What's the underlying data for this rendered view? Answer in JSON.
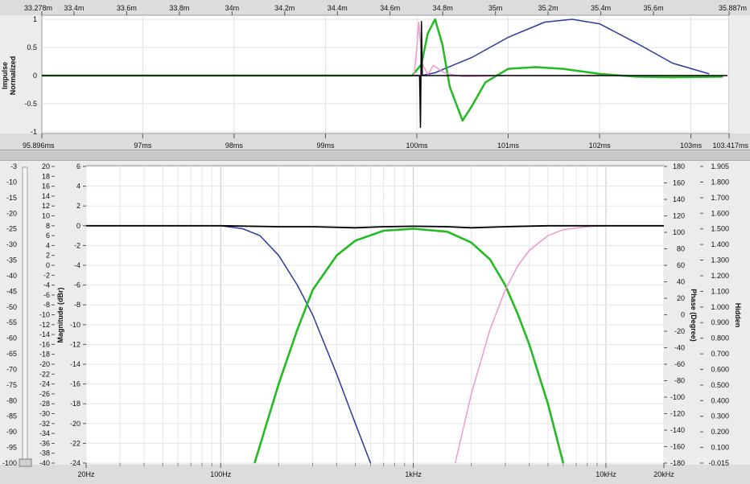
{
  "impulse_panel": {
    "ylabel_line1": "Impulse",
    "ylabel_line2": "Normalized",
    "top_ticks": [
      "33.278m",
      "33.4m",
      "33.6m",
      "33.8m",
      "34m",
      "34.2m",
      "34.4m",
      "34.6m",
      "34.8m",
      "35m",
      "35.2m",
      "35.4m",
      "35.6m",
      "35.887m"
    ],
    "bottom_ticks": [
      "95.896ms",
      "97ms",
      "98ms",
      "99ms",
      "100ms",
      "101ms",
      "102ms",
      "103ms",
      "103.417ms"
    ],
    "y_ticks": [
      "1",
      "0.5",
      "0",
      "-0.5",
      "-1"
    ]
  },
  "response_panel": {
    "left_scale_ticks": [
      "-3",
      "-10",
      "-15",
      "-20",
      "-25",
      "-30",
      "-35",
      "-40",
      "-45",
      "-50",
      "-55",
      "-60",
      "-65",
      "-70",
      "-75",
      "-80",
      "-85",
      "-90",
      "-95",
      "-100"
    ],
    "mag_ticks": [
      "20",
      "18",
      "16",
      "14",
      "12",
      "10",
      "8",
      "6",
      "4",
      "2",
      "0",
      "-2",
      "-4",
      "-6",
      "-8",
      "-10",
      "-12",
      "-14",
      "-16",
      "-18",
      "-20",
      "-22",
      "-24",
      "-26",
      "-28",
      "-30",
      "-32",
      "-34",
      "-36",
      "-38",
      "-40"
    ],
    "grid_ticks": [
      "6",
      "4",
      "2",
      "0",
      "-2",
      "-4",
      "-6",
      "-8",
      "-10",
      "-12",
      "-14",
      "-16",
      "-18",
      "-20",
      "-22",
      "-24"
    ],
    "phase_ticks": [
      "180",
      "160",
      "140",
      "120",
      "100",
      "80",
      "60",
      "40",
      "20",
      "0",
      "-20",
      "-40",
      "-60",
      "-80",
      "-100",
      "-120",
      "-140",
      "-160",
      "-180"
    ],
    "hidden_ticks": [
      "1.905",
      "1.800",
      "1.700",
      "1.600",
      "1.500",
      "1.400",
      "1.300",
      "1.200",
      "1.100",
      "1.000",
      "0.900",
      "0.800",
      "0.700",
      "0.600",
      "0.500",
      "0.400",
      "0.300",
      "0.200",
      "0.100",
      "-0.015"
    ],
    "freq_ticks": [
      "20Hz",
      "100Hz",
      "1kHz",
      "10kHz",
      "20kHz"
    ],
    "mag_label": "Magnitude (dBr)",
    "phase_label": "Phase (Degree)",
    "hidden_label": "Hidden"
  },
  "colors": {
    "low": "#2b3aa0",
    "mid": "#22bb22",
    "high": "#ee99cc",
    "sum": "#000000",
    "hidden_label": "#2255dd"
  },
  "chart_data": [
    {
      "type": "line",
      "xlabel": "",
      "ylabel": "Impulse Normalized",
      "xlim_ms": [
        95.896,
        103.417
      ],
      "ylim": [
        -1,
        1
      ],
      "series": [
        {
          "color": "#2b3aa0",
          "x": [
            95.896,
            99.9,
            100.05,
            100.2,
            100.3,
            100.6,
            101.0,
            101.4,
            101.7,
            102.0,
            102.4,
            102.8,
            103.2
          ],
          "y": [
            0,
            0,
            0,
            0.05,
            0.12,
            0.32,
            0.68,
            0.95,
            1.0,
            0.92,
            0.58,
            0.22,
            0.03
          ]
        },
        {
          "color": "#22bb22",
          "x": [
            95.896,
            99.95,
            100.05,
            100.12,
            100.2,
            100.28,
            100.36,
            100.5,
            100.6,
            100.75,
            101.0,
            101.3,
            101.6,
            102.0,
            102.4,
            102.8,
            103.35
          ],
          "y": [
            0,
            0,
            0.2,
            0.75,
            1.0,
            0.55,
            -0.2,
            -0.8,
            -0.55,
            -0.12,
            0.12,
            0.15,
            0.12,
            0.03,
            -0.02,
            -0.03,
            -0.02
          ]
        },
        {
          "color": "#ee99cc",
          "x": [
            95.896,
            99.97,
            100.0,
            100.02,
            100.06,
            100.12,
            100.18,
            100.3,
            100.5,
            101.0,
            102.0,
            103.2
          ],
          "y": [
            0,
            0,
            0.5,
            0.95,
            0.2,
            0.02,
            0.18,
            0.05,
            -0.02,
            0,
            0,
            0
          ]
        },
        {
          "color": "#000000",
          "x": [
            95.896,
            100.03,
            100.04,
            100.05,
            100.06,
            103.4
          ],
          "y": [
            0,
            0,
            -0.92,
            0.96,
            0,
            0
          ]
        }
      ]
    },
    {
      "type": "line",
      "xlabel": "",
      "ylabel": "Magnitude (dBr)",
      "xscale": "log",
      "xlim_hz": [
        20,
        20000
      ],
      "ylim_db": [
        -24,
        6
      ],
      "series": [
        {
          "color": "#2b3aa0",
          "x": [
            80,
            100,
            130,
            160,
            200,
            250,
            300,
            400,
            500,
            600
          ],
          "y": [
            0,
            0,
            -0.3,
            -1.0,
            -3.0,
            -6.0,
            -9.0,
            -15.0,
            -20.0,
            -24.0
          ]
        },
        {
          "color": "#22bb22",
          "x": [
            150,
            200,
            250,
            300,
            400,
            500,
            700,
            1000,
            1500,
            2000,
            2500,
            3000,
            3500,
            4000,
            5000,
            6000
          ],
          "y": [
            -24,
            -16,
            -10.5,
            -6.5,
            -3.0,
            -1.5,
            -0.5,
            -0.3,
            -0.6,
            -1.7,
            -3.4,
            -6.0,
            -9.0,
            -12.0,
            -18.0,
            -24.0
          ]
        },
        {
          "color": "#ee99cc",
          "x": [
            1650,
            2000,
            2500,
            3000,
            3500,
            4000,
            5000,
            6000,
            8000,
            10000
          ],
          "y": [
            -24,
            -17,
            -10.5,
            -6.5,
            -4.0,
            -2.5,
            -1.0,
            -0.4,
            -0.1,
            0
          ]
        },
        {
          "color": "#000000",
          "x": [
            20,
            100,
            200,
            300,
            500,
            700,
            1000,
            1500,
            2000,
            3000,
            5000,
            10000,
            20000
          ],
          "y": [
            0,
            0,
            -0.1,
            -0.1,
            -0.2,
            -0.1,
            -0.05,
            -0.1,
            -0.2,
            -0.1,
            0,
            0,
            0
          ]
        }
      ]
    }
  ]
}
